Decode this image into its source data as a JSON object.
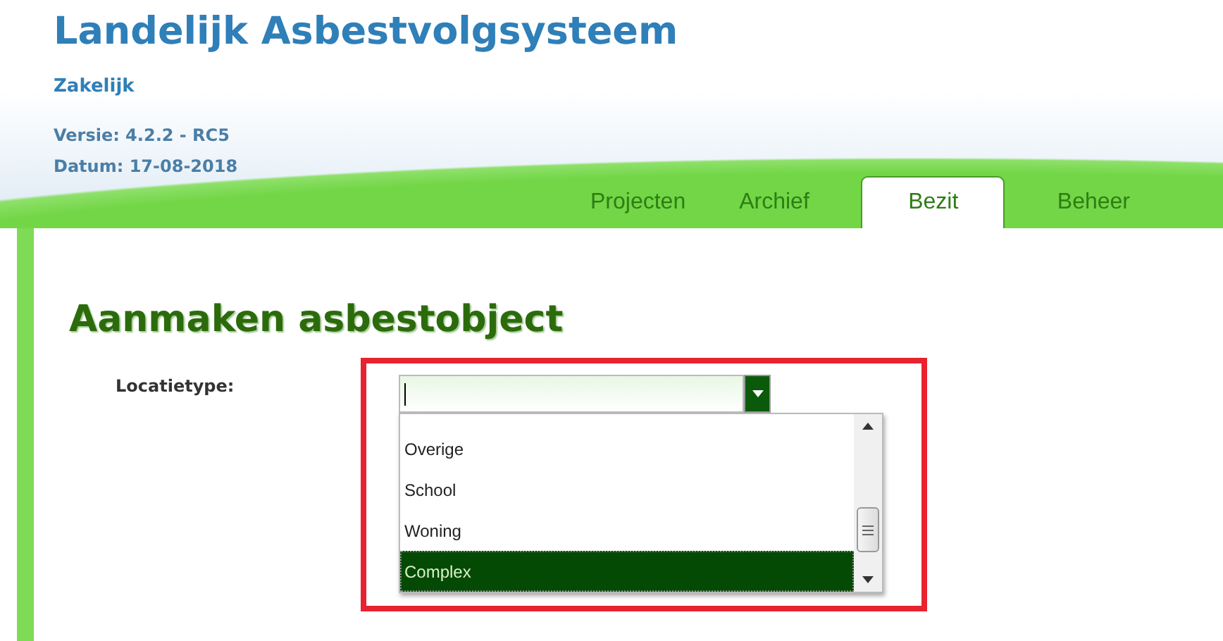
{
  "header": {
    "title": "Landelijk Asbestvolgsysteem",
    "subtitle": "Zakelijk",
    "version": "Versie: 4.2.2 - RC5",
    "date": "Datum: 17-08-2018"
  },
  "tabs": [
    {
      "label": "Projecten",
      "selected": false
    },
    {
      "label": "Archief",
      "selected": false
    },
    {
      "label": "Bezit",
      "selected": true
    },
    {
      "label": "Beheer",
      "selected": false
    }
  ],
  "heading": "Aanmaken asbestobject",
  "form": {
    "label": "Locatietype:",
    "options": [
      {
        "label": "Overige",
        "selected": false
      },
      {
        "label": "School",
        "selected": false
      },
      {
        "label": "Woning",
        "selected": false
      },
      {
        "label": "Complex",
        "selected": true
      }
    ]
  }
}
